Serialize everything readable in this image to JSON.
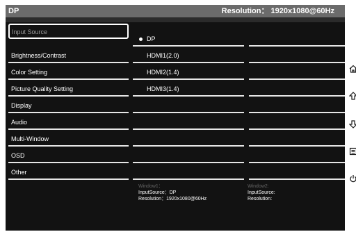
{
  "header": {
    "title": "DP",
    "resolution": "Resolution： 1920x1080@60Hz"
  },
  "menu": {
    "items": [
      {
        "label": "Input Source"
      },
      {
        "label": "Brightness/Contrast"
      },
      {
        "label": "Color Setting"
      },
      {
        "label": "Picture Quality Setting"
      },
      {
        "label": "Display"
      },
      {
        "label": "Audio"
      },
      {
        "label": "Multi-Window"
      },
      {
        "label": "OSD"
      },
      {
        "label": "Other"
      }
    ]
  },
  "options": {
    "items": [
      {
        "label": "DP"
      },
      {
        "label": "HDMI1(2.0)"
      },
      {
        "label": "HDMI2(1.4)"
      },
      {
        "label": "HDMI3(1.4)"
      }
    ]
  },
  "window1": {
    "title": "Window1：",
    "input": "InputSource：DP",
    "resolution": "Resolution：1920x1080@60Hz"
  },
  "window2": {
    "title": "Window2:",
    "input": "InputSource:",
    "resolution": "Resolution:"
  },
  "sidebar": {
    "icons": [
      "home-icon",
      "up-arrow-icon",
      "down-arrow-icon",
      "menu-icon",
      "power-icon"
    ]
  }
}
